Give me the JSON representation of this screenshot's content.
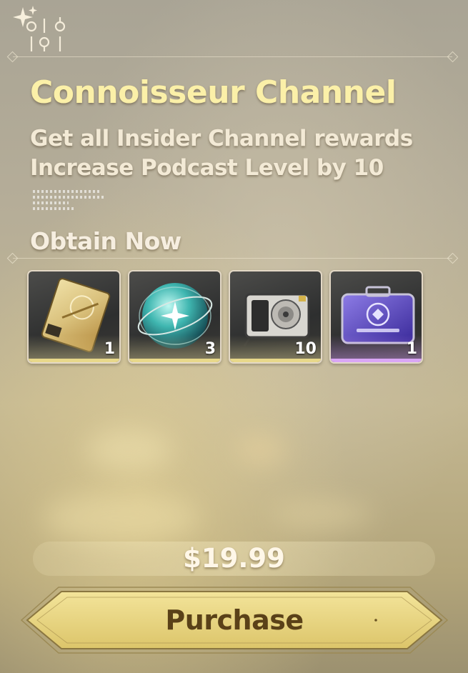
{
  "header": {
    "title": "Connoisseur Channel",
    "description": [
      "Get all Insider Channel rewards",
      "Increase Podcast Level by 10"
    ]
  },
  "rewards": {
    "heading": "Obtain Now",
    "items": [
      {
        "icon": "card-icon",
        "count": "1",
        "rarity": "gold"
      },
      {
        "icon": "orb-icon",
        "count": "3",
        "rarity": "gold"
      },
      {
        "icon": "device-icon",
        "count": "10",
        "rarity": "gold"
      },
      {
        "icon": "case-icon",
        "count": "1",
        "rarity": "purple"
      }
    ]
  },
  "footer": {
    "price": "$19.99",
    "purchase_label": "Purchase"
  },
  "colors": {
    "title": "#fbf0a8",
    "button_gold": "#e9d778",
    "button_text": "#5a4118",
    "purple_rarity": "#d9a6f5"
  }
}
